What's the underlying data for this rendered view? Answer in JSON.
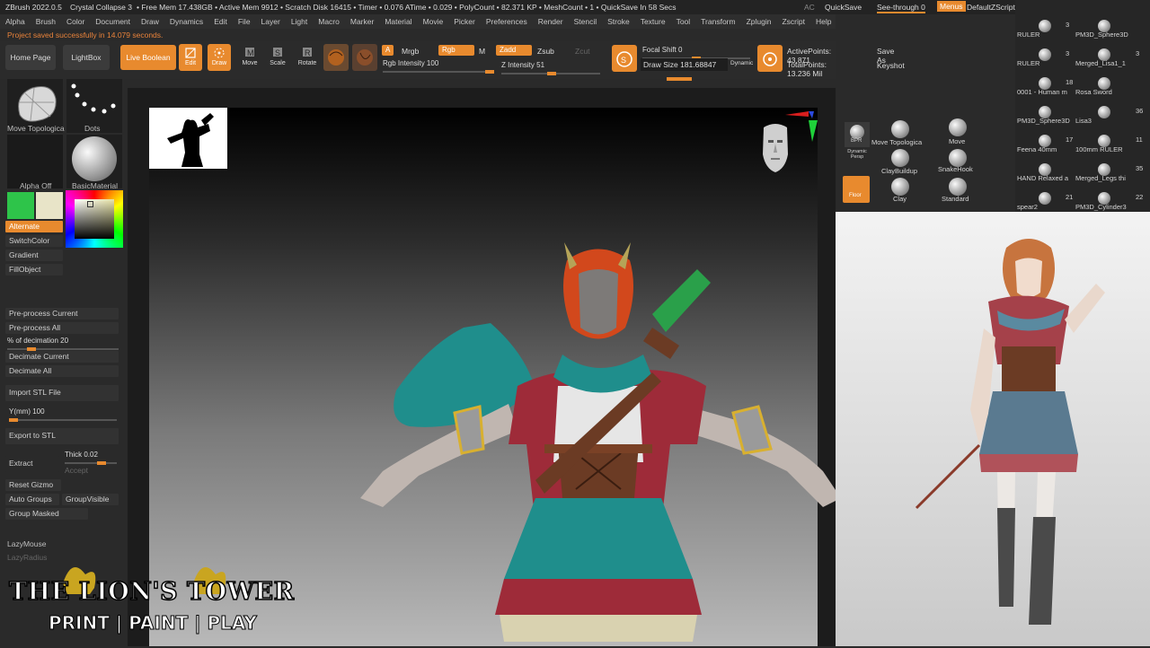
{
  "titlebar": {
    "app": "ZBrush 2022.0.5",
    "project": "Crystal Collapse 3",
    "stats": "• Free Mem 17.438GB • Active Mem 9912 • Scratch Disk 16415 • Timer • 0.076 ATime • 0.029 • PolyCount • 82.371 KP • MeshCount • 1 • QuickSave In 58 Secs",
    "ac": "AC",
    "quicksave": "QuickSave",
    "seethrough": "See-through  0",
    "menus": "Menus",
    "script": "DefaultZScript"
  },
  "menu": [
    "Alpha",
    "Brush",
    "Color",
    "Document",
    "Draw",
    "Dynamics",
    "Edit",
    "File",
    "Layer",
    "Light",
    "Macro",
    "Marker",
    "Material",
    "Movie",
    "Picker",
    "Preferences",
    "Render",
    "Stencil",
    "Stroke",
    "Texture",
    "Tool",
    "Transform",
    "Zplugin",
    "Zscript",
    "Help"
  ],
  "notice": "Project saved successfully in 14.079 seconds.",
  "toolbar": {
    "home": "Home Page",
    "lightbox": "LightBox",
    "liveboolean": "Live Boolean",
    "edit": "Edit",
    "draw": "Draw",
    "move": "Move",
    "scale": "Scale",
    "rotate": "Rotate",
    "a": "A",
    "mrgb": "Mrgb",
    "rgb": "Rgb",
    "m": "M",
    "zadd": "Zadd",
    "zsub": "Zsub",
    "zcut": "Zcut",
    "rgb_intensity": "Rgb Intensity 100",
    "z_intensity": "Z Intensity 51",
    "focal_shift": "Focal Shift 0",
    "draw_size": "Draw Size 181.68847",
    "dynamic": "Dynamic",
    "active_points": "ActivePoints: 43,871",
    "total_points": "TotalPoints: 13.236 Mil",
    "save_as": "Save As",
    "keyshot": "Keyshot",
    "progress": {
      "rgb_intensity": 1.0,
      "z_intensity": 0.51
    }
  },
  "left": {
    "brush_name": "Move Topologica",
    "stroke_name": "Dots",
    "alpha_name": "Alpha Off",
    "material_name": "BasicMaterial",
    "alternate": "Alternate",
    "switchcolor": "SwitchColor",
    "gradient": "Gradient",
    "fillobject": "FillObject",
    "preprocess_current": "Pre-process Current",
    "preprocess_all": "Pre-process All",
    "pct_decimation": "% of decimation 20",
    "decimate_current": "Decimate Current",
    "decimate_all": "Decimate All",
    "import_stl": "Import STL File",
    "ymm": "Y(mm) 100",
    "export_stl": "Export to STL",
    "extract": "Extract",
    "thick": "Thick 0.02",
    "accept": "Accept",
    "reset_gizmo": "Reset Gizmo",
    "auto_groups": "Auto Groups",
    "group_visible": "GroupVisible",
    "group_masked": "Group Masked",
    "lazymouse": "LazyMouse",
    "lazyradius": "LazyRadius",
    "colors": {
      "main": "#2ec44a",
      "secondary": "#e8e4c8"
    }
  },
  "brushes": {
    "bpr": "BPR",
    "dynamic_persp": "Dynamic Persp",
    "floor": "Floor",
    "items": [
      "Move Topologica",
      "Move",
      "ClayBuildup",
      "SnakeHook",
      "Clay",
      "Standard"
    ]
  },
  "tools": [
    {
      "name": "RULER",
      "count": "3",
      "name2": "PM3D_Sphere3D",
      "count2": ""
    },
    {
      "name": "RULER",
      "count": "3",
      "name2": "Merged_Lisa1_1",
      "count2": "3"
    },
    {
      "name": "0001 - Human m",
      "count": "18",
      "name2": "Rosa Sword",
      "count2": ""
    },
    {
      "name": "PM3D_Sphere3D",
      "count": "",
      "name2": "Lisa3",
      "count2": "36"
    },
    {
      "name": "Feena 40mm",
      "count": "17",
      "name2": "100mm RULER",
      "count2": "11"
    },
    {
      "name": "HAND Relaxed a",
      "count": "",
      "name2": "Merged_Legs thi",
      "count2": "35"
    },
    {
      "name": "spear2",
      "count": "21",
      "name2": "PM3D_Cylinder3",
      "count2": "22"
    }
  ],
  "logo": {
    "title": "THE LION'S TOWER",
    "tagline": "PRINT | PAINT | PLAY"
  }
}
